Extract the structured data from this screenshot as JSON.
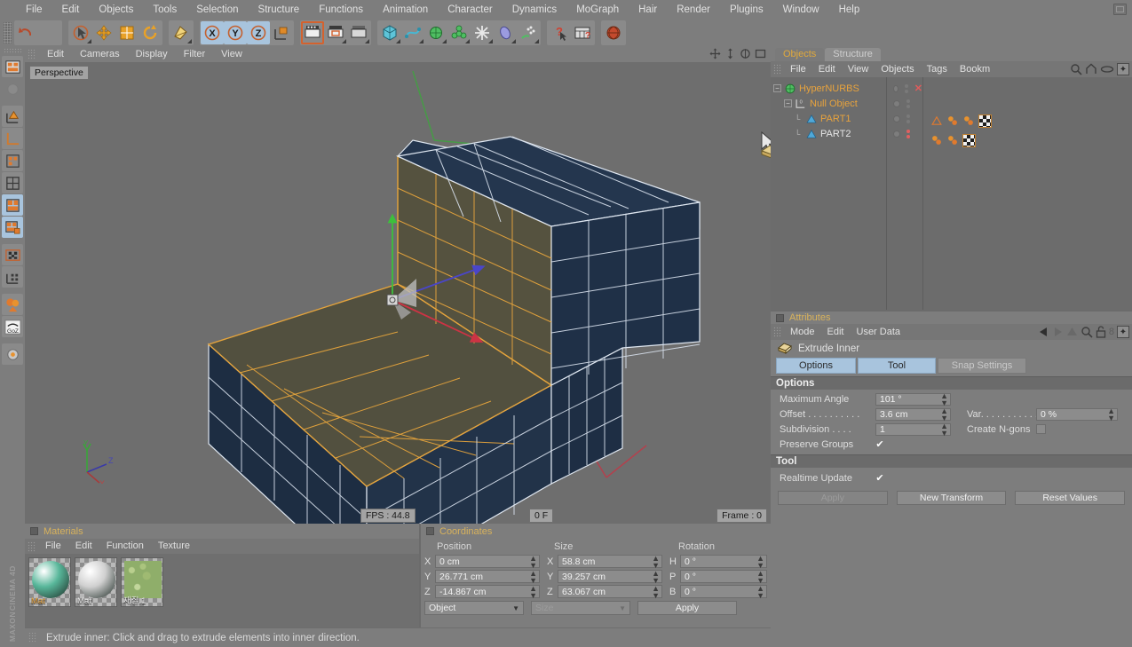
{
  "menubar": {
    "items": [
      "File",
      "Edit",
      "Objects",
      "Tools",
      "Selection",
      "Structure",
      "Functions",
      "Animation",
      "Character",
      "Dynamics",
      "MoGraph",
      "Hair",
      "Render",
      "Plugins",
      "Window",
      "Help"
    ],
    "layout_icon": "layout-icon"
  },
  "toolbar": {
    "groups": [
      {
        "name": "history",
        "buttons": [
          {
            "name": "undo-icon",
            "label": "Undo",
            "state": "normal"
          },
          {
            "name": "redo-icon",
            "label": "Redo",
            "state": "disabled"
          }
        ]
      },
      {
        "name": "tools",
        "buttons": [
          {
            "name": "select-tool-icon",
            "label": "Live Selection",
            "state": "normal"
          },
          {
            "name": "move-tool-icon",
            "label": "Move",
            "state": "normal"
          },
          {
            "name": "scale-tool-icon",
            "label": "Scale",
            "state": "normal"
          },
          {
            "name": "rotate-tool-icon",
            "label": "Rotate",
            "state": "normal"
          }
        ]
      },
      {
        "name": "world",
        "buttons": [
          {
            "name": "world-object-axis-icon",
            "label": "World/Object Axis",
            "state": "normal"
          }
        ]
      },
      {
        "name": "axis-locks",
        "buttons": [
          {
            "name": "lock-x-icon",
            "label": "X",
            "state": "selected"
          },
          {
            "name": "lock-y-icon",
            "label": "Y",
            "state": "selected"
          },
          {
            "name": "lock-z-icon",
            "label": "Z",
            "state": "selected"
          },
          {
            "name": "world-coordinate-icon",
            "label": "World Coordinate System",
            "state": "normal"
          }
        ]
      },
      {
        "name": "render",
        "buttons": [
          {
            "name": "render-view-icon",
            "label": "Render View",
            "state": "highlighted"
          },
          {
            "name": "render-region-icon",
            "label": "Render Region",
            "state": "normal"
          },
          {
            "name": "render-settings-icon",
            "label": "Render Settings",
            "state": "normal"
          }
        ]
      },
      {
        "name": "objects",
        "buttons": [
          {
            "name": "cube-primitive-icon",
            "label": "Cube",
            "state": "normal"
          },
          {
            "name": "spline-icon",
            "label": "Spline",
            "state": "normal"
          },
          {
            "name": "nurbs-icon",
            "label": "HyperNURBS",
            "state": "normal"
          },
          {
            "name": "array-icon",
            "label": "Array",
            "state": "normal"
          },
          {
            "name": "deformer-icon",
            "label": "Bend Deformer",
            "state": "normal"
          },
          {
            "name": "light-icon",
            "label": "Light",
            "state": "normal"
          },
          {
            "name": "particles-icon",
            "label": "Emitter",
            "state": "normal"
          }
        ]
      },
      {
        "name": "help",
        "buttons": [
          {
            "name": "help-cursor-icon",
            "label": "Context Help",
            "state": "normal"
          },
          {
            "name": "content-browser-icon",
            "label": "Content Browser",
            "state": "normal"
          }
        ]
      },
      {
        "name": "web",
        "buttons": [
          {
            "name": "globe-icon",
            "label": "Online Updater",
            "state": "normal"
          }
        ]
      }
    ]
  },
  "leftbar": {
    "items": [
      {
        "name": "make-editable-icon",
        "label": "Make Editable",
        "state": "normal"
      },
      {
        "name": "model-mode-icon",
        "label": "Model Mode",
        "state": "disabled"
      },
      {
        "name": "texture-axis-icon",
        "label": "Texture Axis Mode",
        "state": "normal"
      },
      {
        "name": "object-axis-icon",
        "label": "Object Axis Mode",
        "state": "normal"
      },
      {
        "name": "point-mode-icon",
        "label": "Point Mode",
        "state": "normal"
      },
      {
        "name": "edge-mode-icon",
        "label": "Edge Mode",
        "state": "normal"
      },
      {
        "name": "polygon-mode-icon",
        "label": "Polygon Mode",
        "state": "selected"
      },
      {
        "name": "uv-polygon-mode-icon",
        "label": "UV Polygon Mode",
        "state": "selected"
      },
      {
        "name": "texture-mode-icon",
        "label": "Texture Mode",
        "state": "normal"
      },
      {
        "name": "axis-texture-icon",
        "label": "Enable Axis Modification",
        "state": "normal"
      },
      {
        "name": "viewport-solo-icon",
        "label": "Viewport Solo",
        "state": "normal"
      },
      {
        "name": "goz-icon",
        "label": "GoZ",
        "state": "normal"
      },
      {
        "name": "settings-gear-icon",
        "label": "Configure",
        "state": "normal"
      }
    ],
    "brand_line1": "MAXON",
    "brand_line2": "CINEMA 4D"
  },
  "viewport": {
    "menu": [
      "Edit",
      "Cameras",
      "Display",
      "Filter",
      "View"
    ],
    "right_icons": [
      "pan-icon",
      "dolly-icon",
      "rotate-view-icon",
      "maximize-view-icon"
    ],
    "label": "Perspective",
    "fps": "FPS : 44.8",
    "frame_field": "0 F",
    "frame_label": "Frame : 0",
    "axis_gizmo": {
      "x": "X",
      "y": "Y",
      "z": "Z"
    },
    "colors": {
      "background": "#6e6e6e",
      "mesh_fill": "#1f3047",
      "mesh_wire": "#d9e2ee",
      "selected_fill": "#52503f",
      "selected_wire": "#e5a43c",
      "axis_x": "#cc3344",
      "axis_y": "#44cc44",
      "axis_z": "#4444cc"
    }
  },
  "materials": {
    "title": "Materials",
    "menu": [
      "File",
      "Edit",
      "Function",
      "Texture"
    ],
    "items": [
      {
        "name": "Mat",
        "selected": true,
        "color": "#58b79a",
        "kind": "sphere"
      },
      {
        "name": "Mat",
        "selected": false,
        "color": "#d0d0d0",
        "kind": "sphere"
      },
      {
        "name": "재질.1",
        "selected": false,
        "color": "#8fae6a",
        "kind": "texture"
      }
    ]
  },
  "coordinates": {
    "title": "Coordinates",
    "headers": [
      "Position",
      "Size",
      "Rotation"
    ],
    "rows": [
      {
        "pos_axis": "X",
        "pos_value": "0 cm",
        "size_axis": "X",
        "size_value": "58.8 cm",
        "rot_axis": "H",
        "rot_value": "0 °"
      },
      {
        "pos_axis": "Y",
        "pos_value": "26.771 cm",
        "size_axis": "Y",
        "size_value": "39.257 cm",
        "rot_axis": "P",
        "rot_value": "0 °"
      },
      {
        "pos_axis": "Z",
        "pos_value": "-14.867 cm",
        "size_axis": "Z",
        "size_value": "63.067 cm",
        "rot_axis": "B",
        "rot_value": "0 °"
      }
    ],
    "mode_dropdown": "Object",
    "size_dropdown": "Size",
    "apply_label": "Apply"
  },
  "statusbar": {
    "message": "Extrude inner: Click and drag to extrude elements into inner direction."
  },
  "object_manager": {
    "tabs": [
      {
        "label": "Objects",
        "active": true
      },
      {
        "label": "Structure",
        "active": false
      }
    ],
    "menu": [
      "File",
      "Edit",
      "View",
      "Objects",
      "Tags",
      "Bookm"
    ],
    "icons": [
      "search-icon",
      "home-icon",
      "eye-icon",
      "expand-icon"
    ],
    "tree": [
      {
        "label": "HyperNURBS",
        "depth": 0,
        "color": "orange",
        "icon": "hypernurbs-icon",
        "has_x_mark": true,
        "dot_state": "normal"
      },
      {
        "label": "Null Object",
        "depth": 1,
        "color": "orange",
        "icon": "null-object-icon",
        "has_x_mark": false,
        "dot_state": "normal"
      },
      {
        "label": "PART1",
        "depth": 2,
        "color": "orange",
        "icon": "polygon-object-icon",
        "has_x_mark": false,
        "dot_state": "normal"
      },
      {
        "label": "PART2",
        "depth": 2,
        "color": "white",
        "icon": "polygon-object-icon",
        "has_x_mark": false,
        "dot_state": "red"
      }
    ],
    "tags": [
      {
        "row": "PART1",
        "items": [
          "selection-tag-icon",
          "material-tag-icon",
          "material-tag-icon",
          "texture-tag-icon"
        ]
      },
      {
        "row": "PART2",
        "items": [
          "material-tag-icon",
          "material-tag-icon",
          "texture-tag-icon"
        ]
      }
    ]
  },
  "attributes": {
    "title": "Attributes",
    "menu": [
      "Mode",
      "Edit",
      "User Data"
    ],
    "icons": [
      "back-arrow-icon",
      "forward-arrow-icon",
      "up-arrow-icon",
      "search-icon",
      "lock-icon",
      "pin-count-icon",
      "expand-icon"
    ],
    "pin_count": "8",
    "object_icon": "extrude-inner-icon",
    "object_name": "Extrude Inner",
    "tabs": [
      {
        "label": "Options",
        "active": true
      },
      {
        "label": "Tool",
        "active": true
      },
      {
        "label": "Snap Settings",
        "active": false
      }
    ],
    "options_section": "Options",
    "fields": [
      {
        "label": "Maximum Angle",
        "value": "101 °",
        "type": "number"
      },
      {
        "label": "Offset . . . . . . . . . .",
        "value": "3.6 cm",
        "type": "number"
      },
      {
        "label": "Var. . . . . . . . . . .",
        "value": "0 %",
        "type": "number"
      },
      {
        "label": "Subdivision  . . . .",
        "value": "1",
        "type": "number"
      },
      {
        "label": "Create N-gons",
        "value": "",
        "type": "checkbox",
        "checked": false
      },
      {
        "label": "Preserve Groups",
        "value": "",
        "type": "checkbox",
        "checked": true
      }
    ],
    "tool_section": "Tool",
    "realtime_update_label": "Realtime Update",
    "realtime_update_checked": true,
    "buttons": [
      {
        "label": "Apply",
        "disabled": true
      },
      {
        "label": "New Transform",
        "disabled": false
      },
      {
        "label": "Reset Values",
        "disabled": false
      }
    ]
  }
}
